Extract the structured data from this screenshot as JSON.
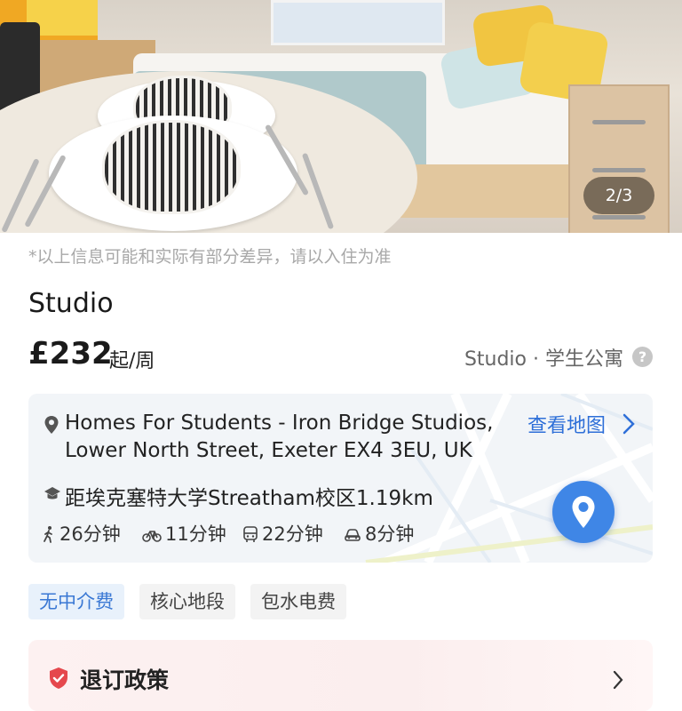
{
  "gallery": {
    "counter": "2/3"
  },
  "listing": {
    "disclaimer": "*以上信息可能和实际有部分差异，请以入住为准",
    "title": "Studio",
    "price": "£232",
    "price_unit": "起/周",
    "room_type": "Studio · 学生公寓",
    "help_icon_glyph": "?"
  },
  "location": {
    "address_line1": "Homes For Students - Iron Bridge Studios,",
    "address_line2": "Lower North Street, Exeter EX4 3EU, UK",
    "map_link": "查看地图",
    "university_distance": "距埃克塞特大学Streatham校区1.19km",
    "commute": {
      "walk": "26分钟",
      "bike": "11分钟",
      "bus": "22分钟",
      "car": "8分钟"
    }
  },
  "tags": [
    "无中介费",
    "核心地段",
    "包水电费"
  ],
  "policy": {
    "title": "退订政策"
  },
  "colors": {
    "accent_blue": "#3f86e6",
    "link_blue": "#2e6fd8",
    "policy_red": "#e5484d"
  },
  "icons": {
    "location": "location-pin-icon",
    "university": "graduation-cap-icon",
    "walk": "walking-icon",
    "bike": "bicycle-icon",
    "bus": "bus-icon",
    "car": "car-icon",
    "map_pin": "map-pin-icon",
    "policy": "shield-icon",
    "chevron": "chevron-right-icon"
  }
}
